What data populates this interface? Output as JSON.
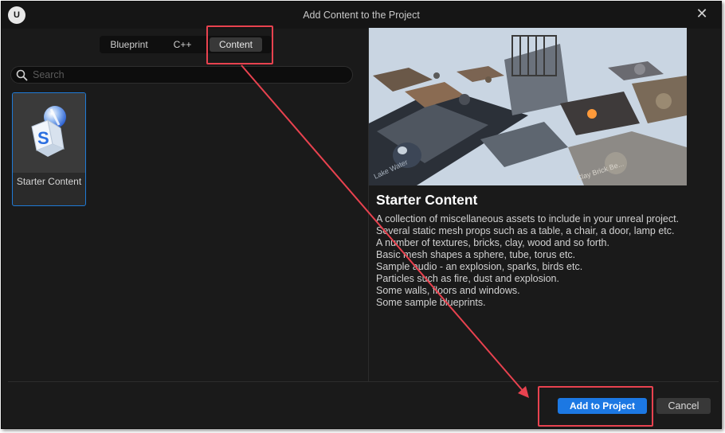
{
  "window": {
    "title": "Add Content to the Project",
    "logo_icon": "unreal-engine-logo",
    "close_icon": "close-icon"
  },
  "tabs": {
    "items": [
      "Blueprint",
      "C++",
      "Content"
    ],
    "selected": "Content"
  },
  "search": {
    "placeholder": "Search",
    "value": ""
  },
  "content_list": [
    {
      "label": "Starter Content",
      "icon": "starter-content-icon",
      "selected": true
    }
  ],
  "detail": {
    "title": "Starter Content",
    "lines": [
      "A collection of miscellaneous assets to include in your unreal project.",
      "Several static mesh props such as a table, a chair, a door, lamp etc.",
      "A number of textures, bricks, clay, wood and so forth.",
      "Basic mesh shapes a sphere, tube, torus etc.",
      "Sample audio - an explosion, sparks, birds etc.",
      "Particles such as fire, dust and explosion.",
      "Some walls, floors and windows.",
      "Some sample blueprints."
    ],
    "preview_labels": [
      "Lake Water",
      "Clay Brick Be..."
    ]
  },
  "footer": {
    "add_label": "Add to Project",
    "cancel_label": "Cancel"
  },
  "colors": {
    "accent": "#1c78e3",
    "highlight_annotation": "#e8424f",
    "background": "#1a1a1a"
  }
}
